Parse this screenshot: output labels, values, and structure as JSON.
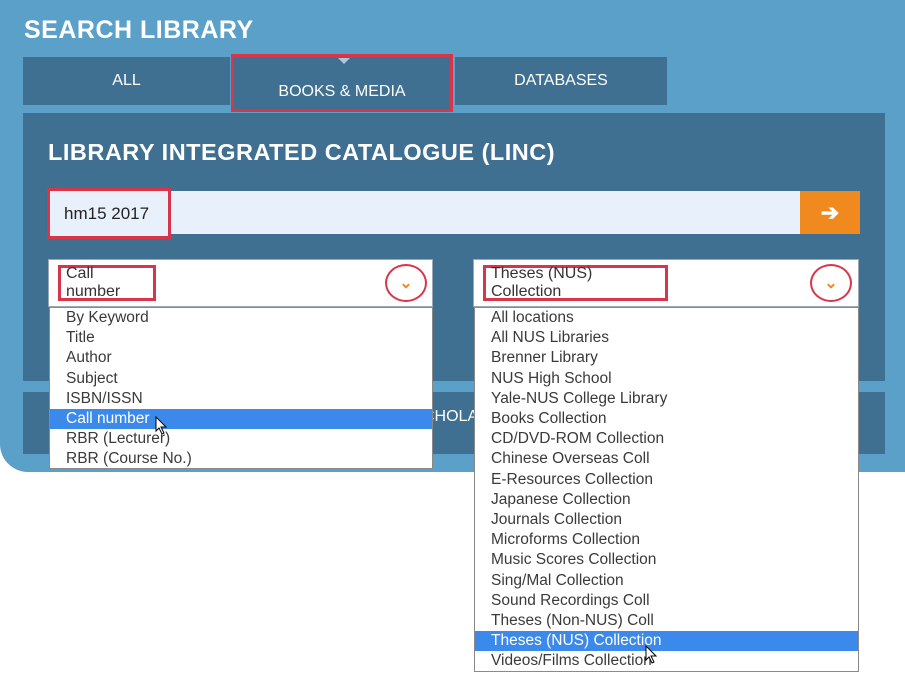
{
  "header": {
    "title": "SEARCH LIBRARY"
  },
  "tabs": [
    {
      "label": "ALL"
    },
    {
      "label": "BOOKS & MEDIA"
    },
    {
      "label": "DATABASES"
    }
  ],
  "catalogue": {
    "title": "LIBRARY INTEGRATED CATALOGUE (LINC)",
    "search_value": "hm15 2017",
    "go_icon": "arrow-right-icon"
  },
  "search_type": {
    "selected": "Call number",
    "options": [
      "By Keyword",
      "Title",
      "Author",
      "Subject",
      "ISBN/ISSN",
      "Call number",
      "RBR (Lecturer)",
      "RBR (Course No.)"
    ],
    "highlighted_index": 5
  },
  "location": {
    "selected": "Theses (NUS) Collection",
    "options": [
      "All locations",
      "All NUS Libraries",
      "Brenner Library",
      "NUS High School",
      "Yale-NUS College Library",
      "Books Collection",
      "CD/DVD-ROM Collection",
      "Chinese Overseas Coll",
      "E-Resources Collection",
      "Japanese Collection",
      "Journals Collection",
      "Microforms Collection",
      "Music Scores Collection",
      "Sing/Mal Collection",
      "Sound Recordings Coll",
      "Theses (Non-NUS) Coll",
      "Theses (NUS) Collection",
      "Videos/Films Collection"
    ],
    "highlighted_index": 16
  },
  "bar2": {
    "partial_text": "CHOLA"
  },
  "colors": {
    "panel": "#5ba0c8",
    "dark": "#3f6f91",
    "accent": "#f08a1e",
    "highlight": "#d8344a",
    "selection": "#3b8aeb"
  }
}
